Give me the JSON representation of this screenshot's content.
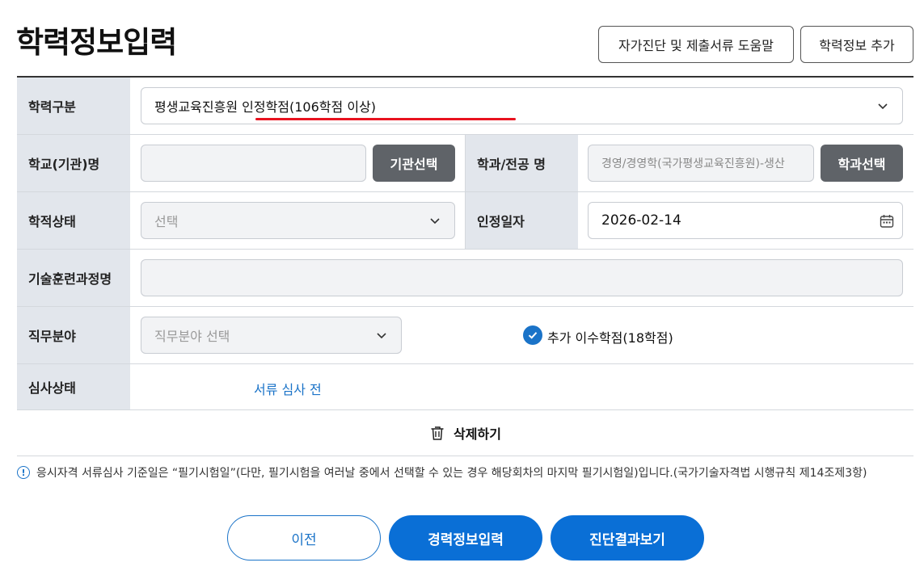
{
  "page": {
    "title": "학력정보입력",
    "help_button": "자가진단 및 제출서류 도움말",
    "add_button": "학력정보 추가"
  },
  "form": {
    "education_type": {
      "label": "학력구분",
      "value": "평생교육진흥원 인정학점(106학점 이상)"
    },
    "school": {
      "label": "학교(기관)명",
      "value": "",
      "button": "기관선택"
    },
    "major": {
      "label": "학과/전공 명",
      "placeholder": "경영/경영학(국가평생교육진흥원)-생산",
      "button": "학과선택"
    },
    "academic_status": {
      "label": "학적상태",
      "placeholder": "선택"
    },
    "certification_date": {
      "label": "인정일자",
      "value": "2026-02-14"
    },
    "training_course": {
      "label": "기술훈련과정명",
      "value": ""
    },
    "job_field": {
      "label": "직무분야",
      "placeholder": "직무분야 선택",
      "extra_credit_label": "추가 이수학점(18학점)",
      "extra_credit_checked": true
    },
    "review_status": {
      "label": "심사상태",
      "value": "서류 심사 전"
    },
    "delete_button": "삭제하기"
  },
  "notice": "응시자격 서류심사 기준일은 “필기시험일”(다만, 필기시험을 여러날 중에서 선택할 수 있는 경우 해당회차의 마지막 필기시험일)입니다.(국가기술자격법 시행규칙 제14조제3항)",
  "navigation": {
    "prev": "이전",
    "next": "경력정보입력",
    "result": "진단결과보기"
  },
  "colors": {
    "accent": "#0a6fd6",
    "label_bg": "#e2e6ec",
    "dark_button": "#5f6368",
    "underline": "#e8121f"
  }
}
